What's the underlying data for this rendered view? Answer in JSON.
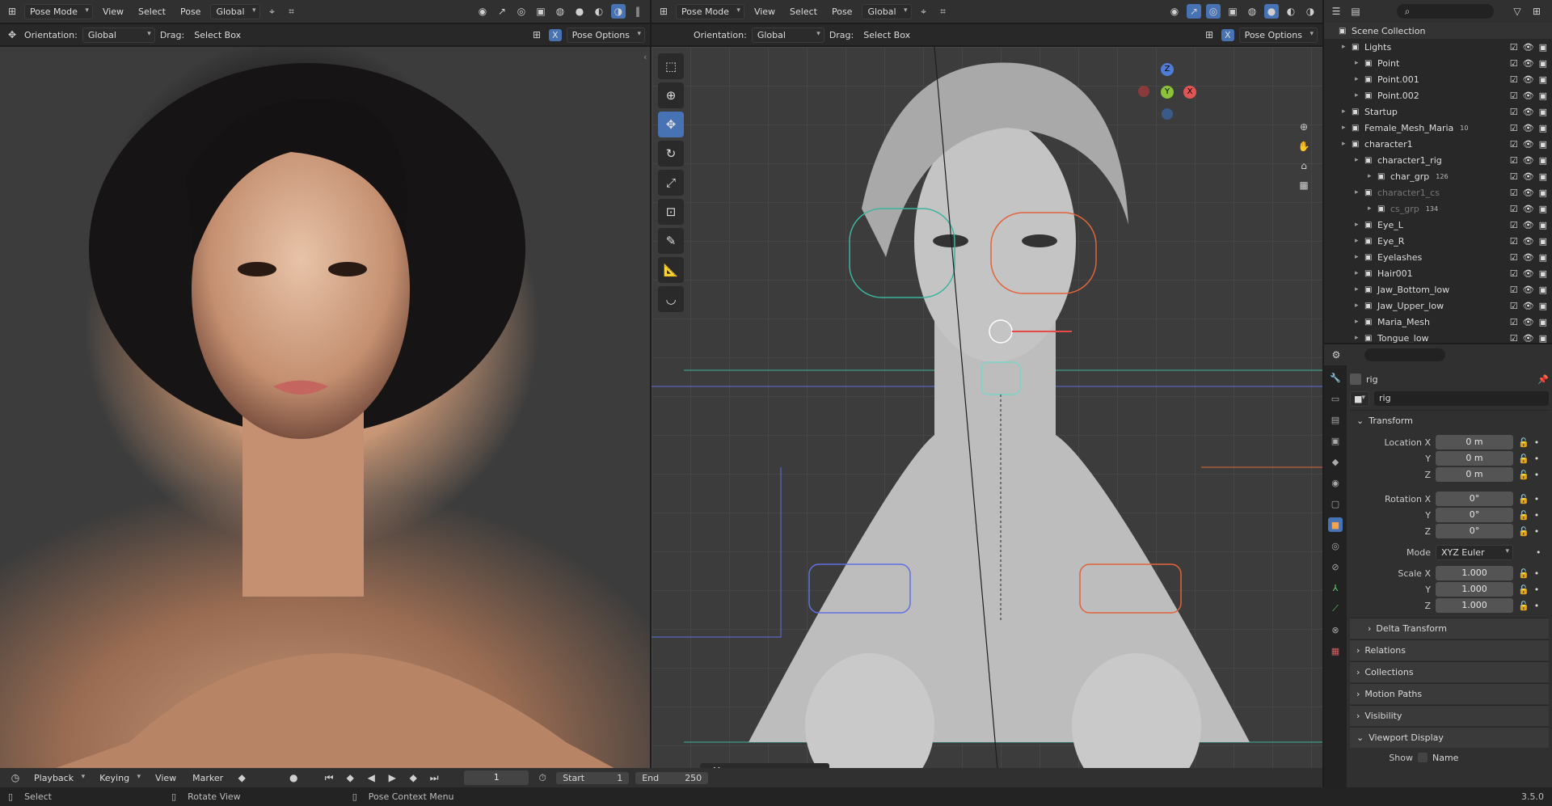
{
  "left_header": {
    "mode": "Pose Mode",
    "menus": [
      "View",
      "Select",
      "Pose"
    ],
    "orientation_dd": "Global"
  },
  "left_tool_header": {
    "orientation_label": "Orientation:",
    "orientation": "Global",
    "drag_label": "Drag:",
    "drag": "Select Box",
    "x_label": "X",
    "pose_options": "Pose Options"
  },
  "right_header": {
    "mode": "Pose Mode",
    "menus": [
      "View",
      "Select",
      "Pose"
    ],
    "orientation_dd": "Global"
  },
  "right_tool_header": {
    "orientation_label": "Orientation:",
    "orientation": "Global",
    "drag_label": "Drag:",
    "drag": "Select Box",
    "x_label": "X",
    "pose_options": "Pose Options"
  },
  "gizmo": {
    "z": "Z",
    "y": "Y",
    "x": "X"
  },
  "last_op": "Move",
  "outliner": {
    "rows": [
      {
        "label": "Scene Collection",
        "indent": 0
      },
      {
        "label": "Lights",
        "indent": 1
      },
      {
        "label": "Point",
        "indent": 2
      },
      {
        "label": "Point.001",
        "indent": 2
      },
      {
        "label": "Point.002",
        "indent": 2
      },
      {
        "label": "Startup",
        "indent": 1
      },
      {
        "label": "Female_Mesh_Maria",
        "indent": 1,
        "badge": "10"
      },
      {
        "label": "character1",
        "indent": 1
      },
      {
        "label": "character1_rig",
        "indent": 2
      },
      {
        "label": "char_grp",
        "indent": 3,
        "badge": "126"
      },
      {
        "label": "character1_cs",
        "indent": 2,
        "dim": true
      },
      {
        "label": "cs_grp",
        "indent": 3,
        "dim": true,
        "badge": "134"
      },
      {
        "label": "Eye_L",
        "indent": 2
      },
      {
        "label": "Eye_R",
        "indent": 2
      },
      {
        "label": "Eyelashes",
        "indent": 2
      },
      {
        "label": "Hair001",
        "indent": 2
      },
      {
        "label": "Jaw_Bottom_low",
        "indent": 2
      },
      {
        "label": "Jaw_Upper_low",
        "indent": 2
      },
      {
        "label": "Maria_Mesh",
        "indent": 2
      },
      {
        "label": "Tongue_low",
        "indent": 2
      }
    ]
  },
  "properties": {
    "object_name": "rig",
    "data_name": "rig",
    "transform_label": "Transform",
    "location": {
      "label": "Location X",
      "y_label": "Y",
      "z_label": "Z",
      "x": "0 m",
      "y": "0 m",
      "z": "0 m"
    },
    "rotation": {
      "label": "Rotation X",
      "y_label": "Y",
      "z_label": "Z",
      "x": "0°",
      "y": "0°",
      "z": "0°"
    },
    "mode_label": "Mode",
    "mode": "XYZ Euler",
    "scale": {
      "label": "Scale X",
      "y_label": "Y",
      "z_label": "Z",
      "x": "1.000",
      "y": "1.000",
      "z": "1.000"
    },
    "sections": [
      "Delta Transform",
      "Relations",
      "Collections",
      "Motion Paths",
      "Visibility",
      "Viewport Display"
    ],
    "show_label": "Show",
    "name_label": "Name"
  },
  "timeline": {
    "menus": [
      "Playback",
      "Keying",
      "View",
      "Marker"
    ],
    "frame": "1",
    "start_label": "Start",
    "start": "1",
    "end_label": "End",
    "end": "250"
  },
  "status": {
    "select": "Select",
    "rotate": "Rotate View",
    "context": "Pose Context Menu",
    "version": "3.5.0"
  }
}
